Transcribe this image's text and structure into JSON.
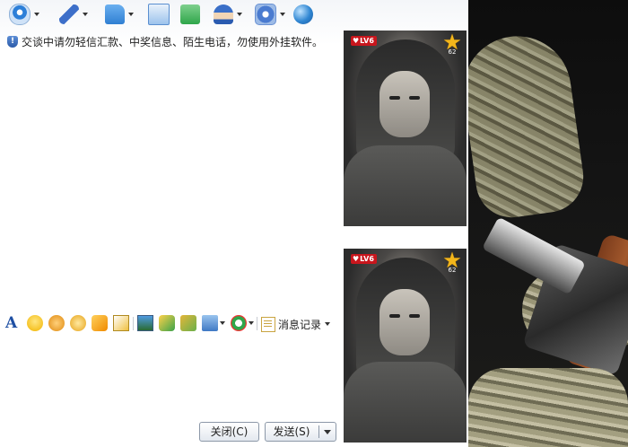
{
  "toolbar": {
    "buttons": [
      {
        "name": "video-chat",
        "icon": "webcam-icon",
        "color": "#2d7fd8",
        "has_dropdown": true
      },
      {
        "name": "voice-chat",
        "icon": "microphone-icon",
        "color": "#3d6fc9",
        "has_dropdown": true
      },
      {
        "name": "send-file",
        "icon": "folder-icon",
        "color": "#3a8de0",
        "has_dropdown": true
      },
      {
        "name": "send-mail",
        "icon": "mail-icon",
        "color": "#5aa0e8",
        "has_dropdown": false
      },
      {
        "name": "sms",
        "icon": "message-icon",
        "color": "#2fa64a",
        "has_dropdown": false
      },
      {
        "name": "remote-assist",
        "icon": "user-cap-icon",
        "color": "#2a5bb0",
        "has_dropdown": true
      },
      {
        "name": "apps",
        "icon": "gear-icon",
        "color": "#4a7bd0",
        "has_dropdown": true
      },
      {
        "name": "more",
        "icon": "globe-icon",
        "color": "#2f86d2",
        "has_dropdown": false
      }
    ]
  },
  "warning": {
    "icon": "shield-icon",
    "text": "交谈中请勿轻信汇款、中奖信息、陌生电话，勿使用外挂软件。"
  },
  "input_toolbar": {
    "font_label": "A",
    "icons": [
      "smiley-icon",
      "magic-face-icon",
      "wink-icon",
      "shake-icon",
      "screenshot-icon",
      "image-icon",
      "doodle-icon",
      "music-icon",
      "screen-share-icon",
      "quick-reply-icon"
    ],
    "history_label": "消息记录"
  },
  "buttons": {
    "close": "关闭(C)",
    "send": "发送(S)"
  },
  "avatars": {
    "top": {
      "level": "LV6",
      "star_count": "62"
    },
    "bottom": {
      "level": "LV6",
      "star_count": "62"
    }
  },
  "colors": {
    "accent": "#1e4fa3",
    "level_badge": "#c8161d",
    "star": "#f3b61b"
  }
}
